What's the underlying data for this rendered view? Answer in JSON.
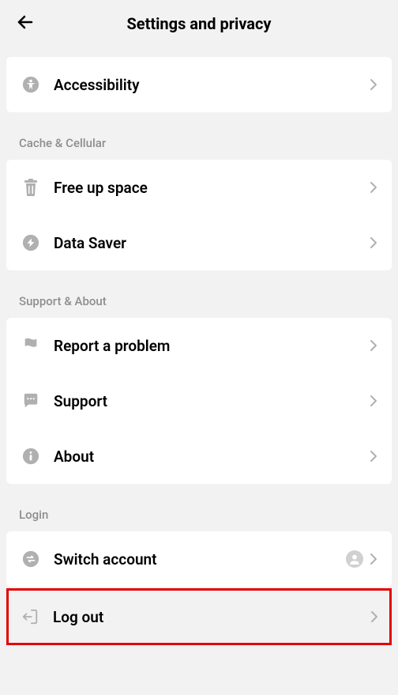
{
  "header": {
    "title": "Settings and privacy"
  },
  "sections": {
    "top": {
      "accessibility_label": "Accessibility"
    },
    "cache": {
      "header": "Cache & Cellular",
      "free_up_space_label": "Free up space",
      "data_saver_label": "Data Saver"
    },
    "support": {
      "header": "Support & About",
      "report_label": "Report a problem",
      "support_label": "Support",
      "about_label": "About"
    },
    "login": {
      "header": "Login",
      "switch_account_label": "Switch account",
      "logout_label": "Log out"
    }
  }
}
